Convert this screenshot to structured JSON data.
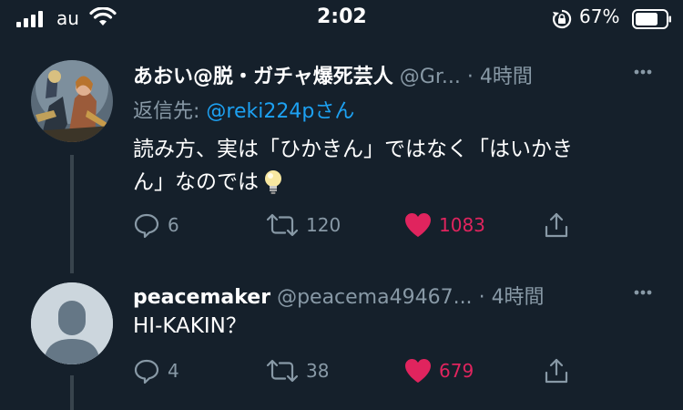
{
  "status_bar": {
    "carrier": "au",
    "time": "2:02",
    "battery_percent": "67%"
  },
  "tweets": [
    {
      "display_name": "あおい@脱・ガチャ爆死芸人",
      "handle": "@Gr...",
      "separator": "·",
      "time": "4時間",
      "reply_prefix": "返信先: ",
      "reply_user": "@reki224p",
      "reply_suffix": "さん",
      "text_line1": "読み方、実は「ひかきん」ではなく「はいかき",
      "text_line2": "ん」なのでは",
      "emoji": "lightbulb",
      "replies": "6",
      "retweets": "120",
      "likes": "1083",
      "liked": true
    },
    {
      "display_name": "peacemaker",
      "handle": "@peacema49467...",
      "separator": "·",
      "time": "4時間",
      "text_line1": "HI-KAKIN？",
      "replies": "4",
      "retweets": "38",
      "likes": "679",
      "liked": true
    }
  ],
  "colors": {
    "background": "#15202b",
    "secondary_text": "#8899a6",
    "link": "#1da1f2",
    "like": "#e0245e",
    "thread_line": "#38444d"
  }
}
